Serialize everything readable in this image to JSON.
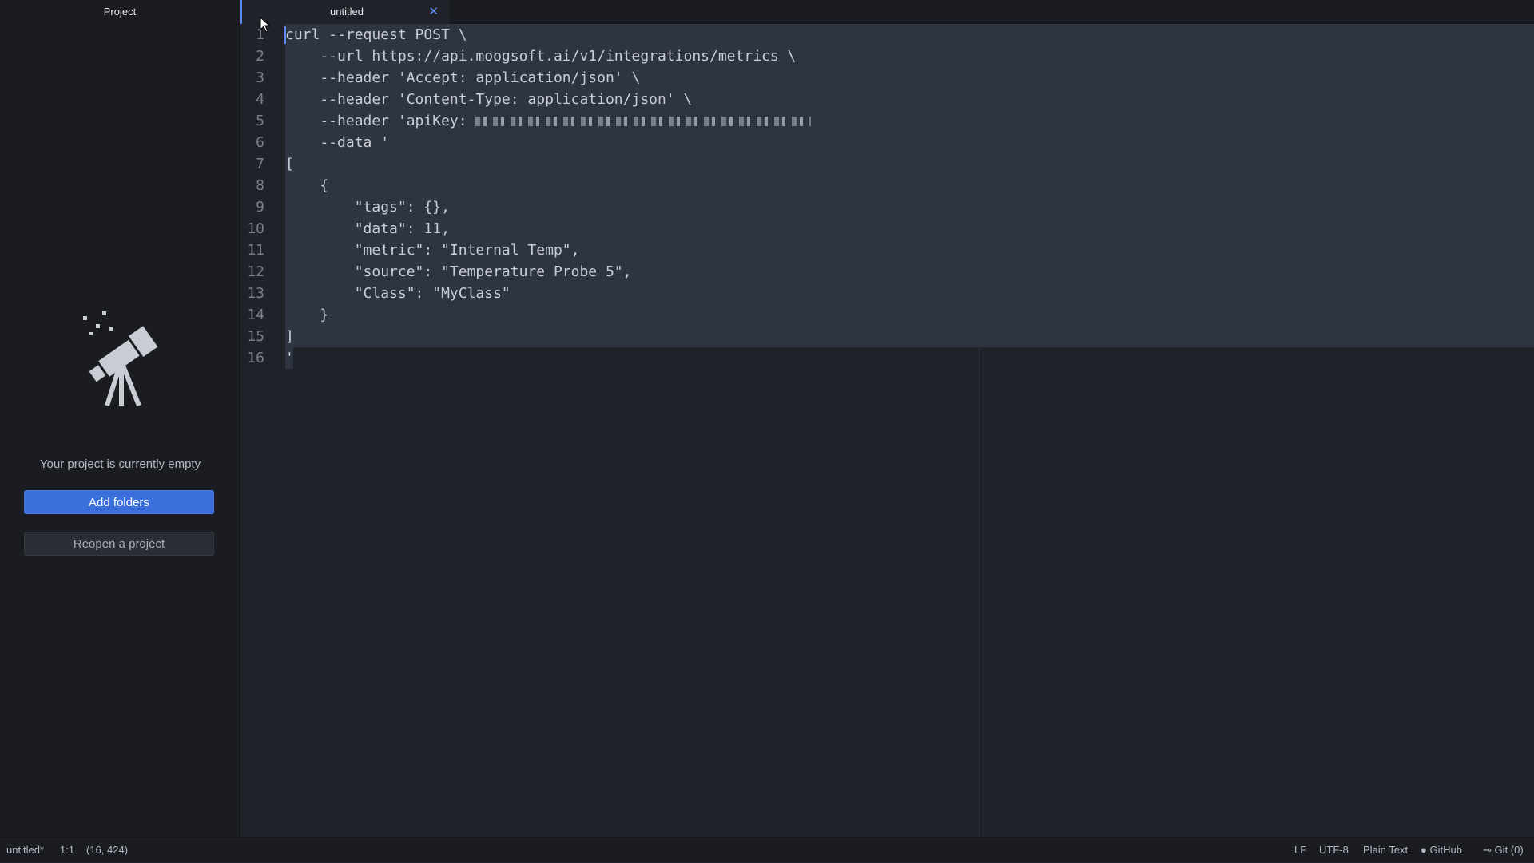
{
  "sidebar": {
    "title": "Project",
    "empty_message": "Your project is currently empty",
    "add_folders_label": "Add folders",
    "reopen_label": "Reopen a project",
    "illustration_icon": "telescope-icon"
  },
  "tabs": [
    {
      "title": "untitled",
      "close_icon": "close-icon",
      "active": true
    }
  ],
  "editor": {
    "line_numbers": [
      "1",
      "2",
      "3",
      "4",
      "5",
      "6",
      "7",
      "8",
      "9",
      "10",
      "11",
      "12",
      "13",
      "14",
      "15",
      "16"
    ],
    "lines": [
      "curl --request POST \\",
      "    --url https://api.moogsoft.ai/v1/integrations/metrics \\",
      "    --header 'Accept: application/json' \\",
      "    --header 'Content-Type: application/json' \\",
      "    --header 'apiKey: ",
      "    --data '",
      "[",
      "    {",
      "        \"tags\": {},",
      "        \"data\": 11,",
      "        \"metric\": \"Internal Temp\",",
      "        \"source\": \"Temperature Probe 5\",",
      "        \"Class\": \"MyClass\"",
      "    }",
      "]",
      "'"
    ]
  },
  "statusbar": {
    "file": "untitled*",
    "cursor_pos": "1:1",
    "selection": "(16, 424)",
    "line_ending": "LF",
    "encoding": "UTF-8",
    "grammar": "Plain Text",
    "github": "GitHub",
    "git": "Git (0)"
  },
  "colors": {
    "accent": "#3b6fd9",
    "background": "#1f2228",
    "sidebar": "#1a1c21",
    "selection": "#2e3440"
  }
}
